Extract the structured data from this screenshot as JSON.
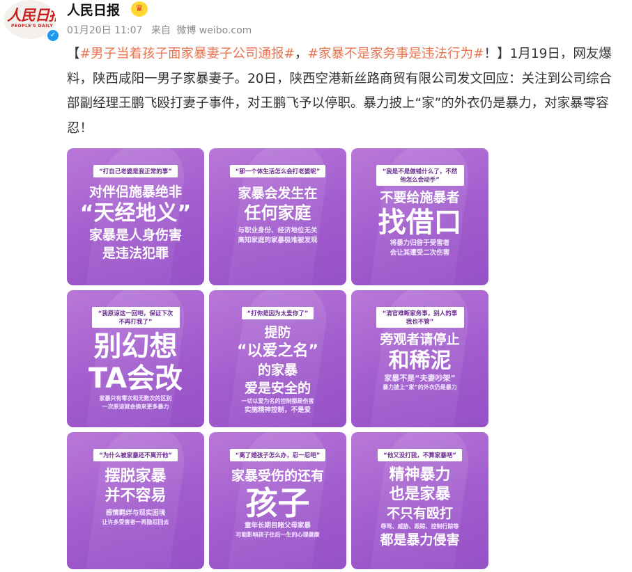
{
  "account": {
    "name": "人民日报",
    "logo_cn": "人民日报",
    "logo_en": "PEOPLE'S DAILY",
    "verified_mark": "✓",
    "crown": "♛",
    "time": "01月20日 11:07",
    "source_prefix": "来自",
    "source": "微博 weibo.com"
  },
  "post": {
    "bracket_open": "【",
    "tag1": "#男子当着孩子面家暴妻子公司通报#",
    "comma": "，",
    "tag2": "#家暴不是家务事是违法行为#",
    "bang": "！",
    "body": "】1月19日，网友爆料，陕西咸阳一男子家暴妻子。20日，陕西空港新丝路商贸有限公司发文回应：关注到公司综合部副经理王鹏飞殴打妻子事件，对王鹏飞予以停职。暴力披上“家”的外衣仍是暴力，对家暴零容忍！"
  },
  "tiles": [
    {
      "quote": "“打自己老婆是我正常的事”",
      "lines": [
        "对伴侣施暴绝非",
        "“天经地义”",
        "家暴是人身伤害",
        "是违法犯罪"
      ]
    },
    {
      "quote": "“那一个体生活怎么会打老婆呢”",
      "lines": [
        "家暴会发生在",
        "任何家庭",
        "与职业身份、经济地位无关",
        "高知家庭的家暴极难被发现"
      ]
    },
    {
      "quote": "“我是不是做错什么了，不然他怎么会动手”",
      "lines": [
        "不要给施暴者",
        "找借口",
        "将暴力归咎于受害者",
        "会让其遭受二次伤害"
      ]
    },
    {
      "quote": "“我原谅这一回吧，保证下次不再打我了”",
      "lines": [
        "别幻想",
        "TA会改",
        "家暴只有零次和无数次的区别",
        "一次原谅就会换来更多暴力"
      ]
    },
    {
      "quote": "“打你是因为太爱你了”",
      "lines": [
        "提防",
        "“以爱之名”",
        "的家暴",
        "爱是安全的",
        "一切以爱为名的控制都是伤害",
        "实施精神控制，不是爱"
      ]
    },
    {
      "quote": "“清官难断家务事，别人的事我也不管”",
      "lines": [
        "旁观者请停止",
        "和稀泥",
        "家暴不是“夫妻吵架”",
        "暴力披上“家”的外衣仍是暴力"
      ]
    },
    {
      "quote": "“为什么被家暴还不离开他”",
      "lines": [
        "摆脱家暴",
        "并不容易",
        "感情羁绊与现实困境",
        "让许多受害者一再隐忍回去"
      ]
    },
    {
      "quote": "“离了婚孩子怎么办，忍一忍吧”",
      "lines": [
        "家暴受伤的还有",
        "孩子",
        "童年长期目睹父母家暴",
        "可能影响孩子往后一生的心理健康"
      ]
    },
    {
      "quote": "“他又没打我，不算家暴吧”",
      "lines": [
        "精神暴力",
        "也是家暴",
        "不只有殴打",
        "辱骂、威胁、跟踪、控制行踪等",
        "都是暴力侵害"
      ]
    }
  ]
}
